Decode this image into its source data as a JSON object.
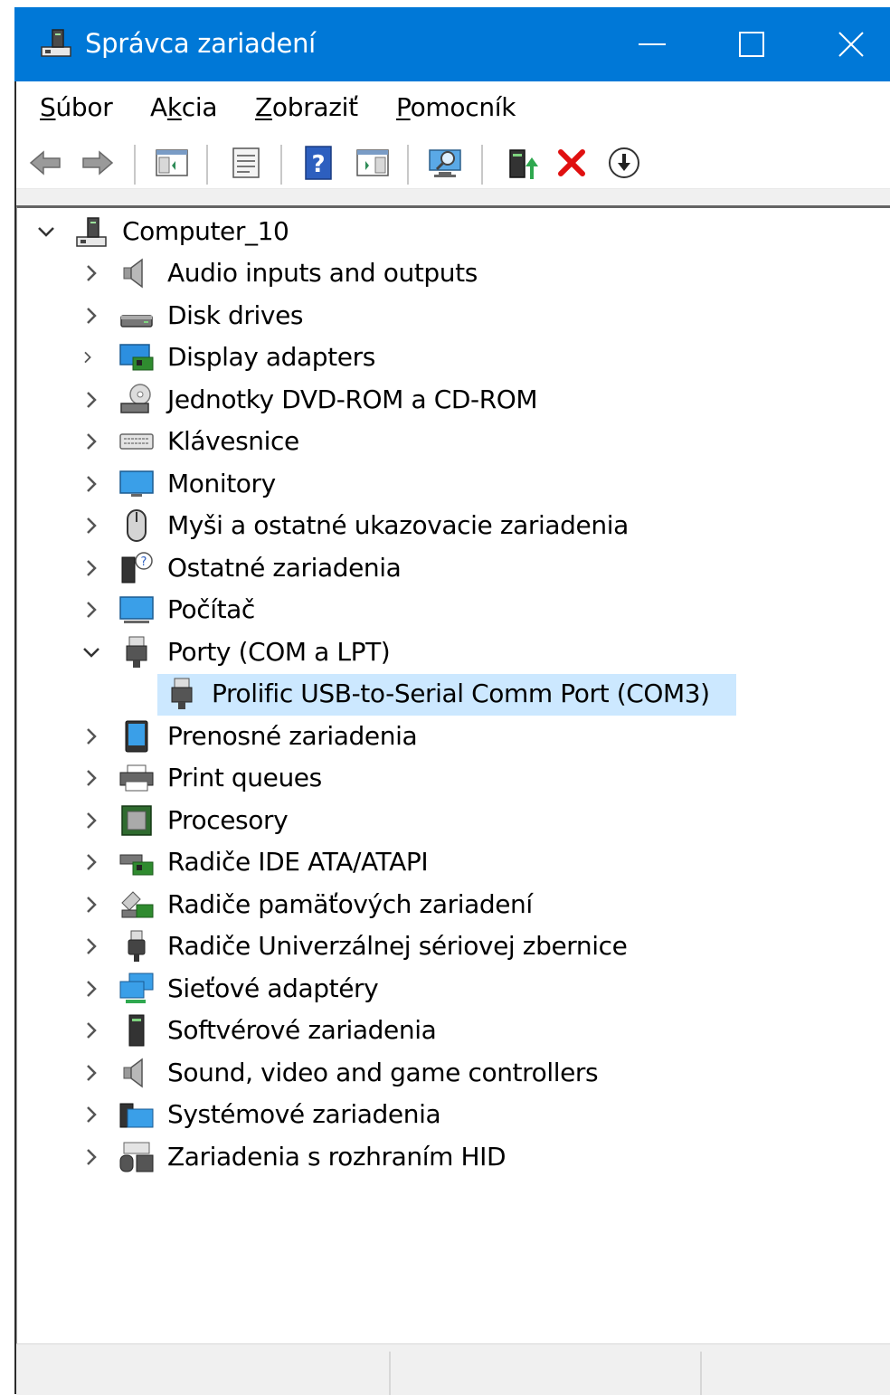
{
  "window": {
    "title": "Správca zariadení",
    "accent": "#0078d7"
  },
  "menu": [
    {
      "pre": "",
      "u": "S",
      "post": "úbor"
    },
    {
      "pre": "A",
      "u": "k",
      "post": "cia"
    },
    {
      "pre": "",
      "u": "Z",
      "post": "obraziť"
    },
    {
      "pre": "",
      "u": "P",
      "post": "omocník"
    }
  ],
  "toolbar": {
    "icons": [
      "back-arrow-icon",
      "forward-arrow-icon",
      "show-hide-console-tree-icon",
      "properties-icon",
      "help-icon",
      "action-pane-icon",
      "scan-hardware-icon",
      "update-driver-icon",
      "uninstall-device-icon",
      "disable-device-icon"
    ]
  },
  "tree": {
    "root": {
      "label": "Computer_10",
      "icon": "computer-icon",
      "expanded": true
    },
    "categories": [
      {
        "label": "Audio inputs and outputs",
        "icon": "speaker-icon"
      },
      {
        "label": "Disk drives",
        "icon": "disk-drive-icon"
      },
      {
        "label": "Display adapters",
        "icon": "display-adapter-icon"
      },
      {
        "label": "Jednotky DVD-ROM a CD-ROM",
        "icon": "dvd-drive-icon"
      },
      {
        "label": "Klávesnice",
        "icon": "keyboard-icon"
      },
      {
        "label": "Monitory",
        "icon": "monitor-icon"
      },
      {
        "label": "Myši a ostatné ukazovacie zariadenia",
        "icon": "mouse-icon"
      },
      {
        "label": "Ostatné zariadenia",
        "icon": "unknown-device-icon"
      },
      {
        "label": "Počítač",
        "icon": "computer-monitor-icon"
      },
      {
        "label": "Porty (COM a LPT)",
        "icon": "port-icon",
        "expanded": true,
        "children": [
          {
            "label": "Prolific USB-to-Serial Comm Port (COM3)",
            "icon": "port-icon",
            "selected": true
          }
        ]
      },
      {
        "label": "Prenosné zariadenia",
        "icon": "portable-device-icon"
      },
      {
        "label": "Print queues",
        "icon": "printer-icon"
      },
      {
        "label": "Procesory",
        "icon": "processor-icon"
      },
      {
        "label": "Radiče IDE ATA/ATAPI",
        "icon": "ide-controller-icon"
      },
      {
        "label": "Radiče pamäťových zariadení",
        "icon": "storage-controller-icon"
      },
      {
        "label": "Radiče Univerzálnej sériovej zbernice",
        "icon": "usb-icon"
      },
      {
        "label": "Sieťové adaptéry",
        "icon": "network-adapter-icon"
      },
      {
        "label": "Softvérové zariadenia",
        "icon": "software-device-icon"
      },
      {
        "label": "Sound, video and game controllers",
        "icon": "speaker-icon"
      },
      {
        "label": "Systémové zariadenia",
        "icon": "system-device-icon"
      },
      {
        "label": "Zariadenia s rozhraním HID",
        "icon": "hid-device-icon"
      }
    ]
  },
  "colors": {
    "selection": "#cce8ff",
    "titlebar": "#0078d7"
  }
}
